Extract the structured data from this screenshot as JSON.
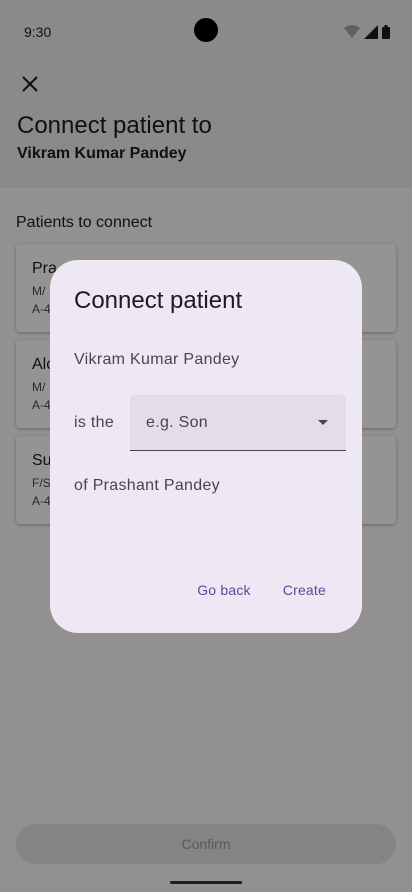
{
  "status_bar": {
    "time": "9:30"
  },
  "header": {
    "close_icon": "close-icon",
    "title": "Connect patient to",
    "subtitle": "Vikram Kumar Pandey"
  },
  "section": {
    "title": "Patients to connect"
  },
  "cards": [
    {
      "name": "Pra",
      "line1": "M/",
      "line2": "A-4"
    },
    {
      "name": "Alo",
      "line1": "M/",
      "line2": "A-4"
    },
    {
      "name": "Su",
      "line1": "F/S",
      "line2": "A-4"
    }
  ],
  "confirm": {
    "label": "Confirm"
  },
  "dialog": {
    "title": "Connect patient",
    "person": "Vikram Kumar Pandey",
    "is_the": "is the",
    "relation_placeholder": "e.g. Son",
    "of_line": "of Prashant Pandey",
    "go_back": "Go back",
    "create": "Create"
  },
  "colors": {
    "accent": "#5b4a9a",
    "dialog_bg": "#eee8f4",
    "scrim": "rgba(0,0,0,0.42)"
  }
}
